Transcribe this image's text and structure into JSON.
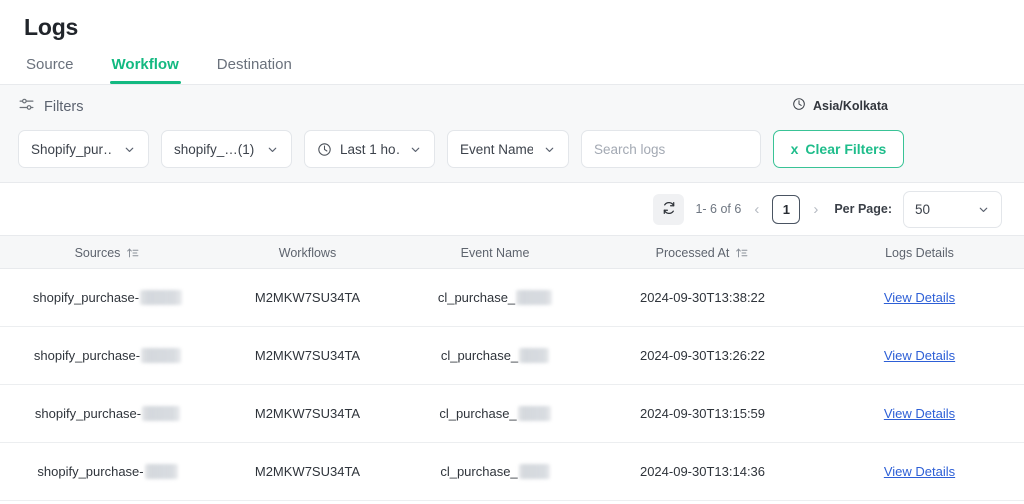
{
  "header": {
    "title": "Logs",
    "tabs": [
      {
        "label": "Source",
        "active": false
      },
      {
        "label": "Workflow",
        "active": true
      },
      {
        "label": "Destination",
        "active": false
      }
    ]
  },
  "filters": {
    "label": "Filters",
    "icon": "sliders-icon",
    "timezone": {
      "icon": "clock-icon",
      "label": "Asia/Kolkata"
    },
    "controls": [
      {
        "name": "source-filter",
        "value": "Shopify_pur…",
        "icon": null
      },
      {
        "name": "workflow-filter",
        "value": "shopify_…(1)",
        "icon": null
      },
      {
        "name": "time-range-filter",
        "value": "Last 1 ho…",
        "icon": "clock-icon"
      },
      {
        "name": "event-name-filter",
        "value": "Event Name",
        "icon": null
      }
    ],
    "search": {
      "placeholder": "Search logs",
      "value": ""
    },
    "clear_button": {
      "label": "Clear Filters",
      "x_glyph": "x",
      "color": "#1fbd8b"
    }
  },
  "pagination": {
    "refresh_icon": "refresh-icon",
    "range": "1- 6 of 6",
    "prev": "‹",
    "next": "›",
    "current_page": "1",
    "per_page_label": "Per Page:",
    "per_page_value": "50"
  },
  "table": {
    "columns": [
      {
        "label": "Sources",
        "sortable": true
      },
      {
        "label": "Workflows",
        "sortable": false
      },
      {
        "label": "Event Name",
        "sortable": false
      },
      {
        "label": "Processed At",
        "sortable": true
      },
      {
        "label": "Logs Details",
        "sortable": false
      }
    ],
    "rows": [
      {
        "source": "shopify_purchase-",
        "source_redacted_width": 42,
        "workflow": "M2MKW7SU34TA",
        "event_name": "cl_purchase_",
        "event_redacted_width": 36,
        "processed_at": "2024-09-30T13:38:22",
        "details_link": "View Details"
      },
      {
        "source": "shopify_purchase-",
        "source_redacted_width": 40,
        "workflow": "M2MKW7SU34TA",
        "event_name": "cl_purchase_",
        "event_redacted_width": 30,
        "processed_at": "2024-09-30T13:26:22",
        "details_link": "View Details"
      },
      {
        "source": "shopify_purchase-",
        "source_redacted_width": 38,
        "workflow": "M2MKW7SU34TA",
        "event_name": "cl_purchase_",
        "event_redacted_width": 33,
        "processed_at": "2024-09-30T13:15:59",
        "details_link": "View Details"
      },
      {
        "source": "shopify_purchase-",
        "source_redacted_width": 33,
        "workflow": "M2MKW7SU34TA",
        "event_name": "cl_purchase_",
        "event_redacted_width": 31,
        "processed_at": "2024-09-30T13:14:36",
        "details_link": "View Details"
      }
    ]
  }
}
